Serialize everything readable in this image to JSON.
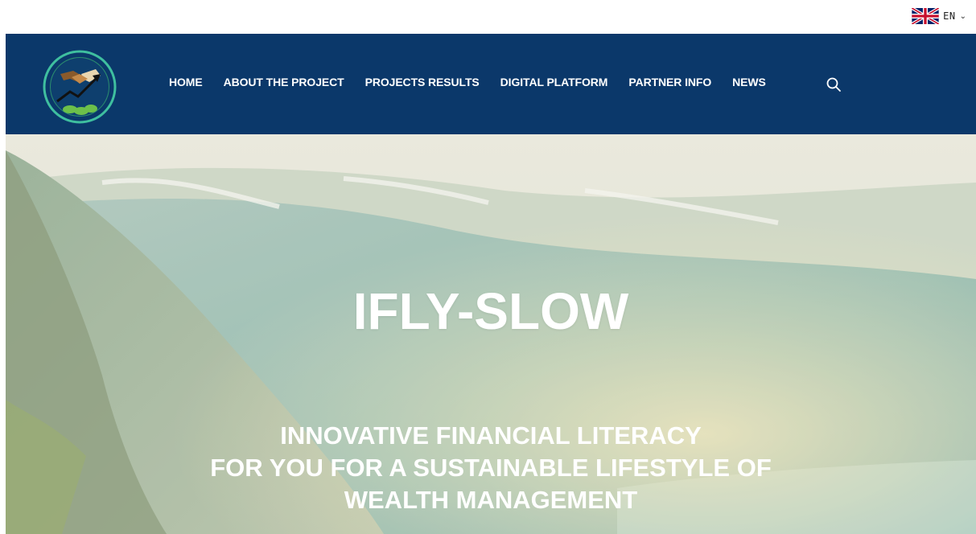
{
  "language": {
    "code": "EN",
    "flag_icon": "uk-flag-icon"
  },
  "nav": {
    "items": [
      {
        "label": "HOME"
      },
      {
        "label": "ABOUT THE PROJECT"
      },
      {
        "label": "PROJECTS RESULTS"
      },
      {
        "label": "DIGITAL PLATFORM"
      },
      {
        "label": "PARTNER INFO"
      },
      {
        "label": "NEWS"
      }
    ],
    "search_icon": "search-icon"
  },
  "hero": {
    "title": "IFLY-SLOW",
    "subtitle_lines": [
      "INNOVATIVE FINANCIAL LITERACY",
      "FOR YOU FOR A SUSTAINABLE LIFESTYLE OF",
      "WEALTH MANAGEMENT"
    ]
  },
  "colors": {
    "navbar_bg": "#0b386a",
    "nav_text": "#ffffff",
    "hero_text": "#ffffff"
  }
}
